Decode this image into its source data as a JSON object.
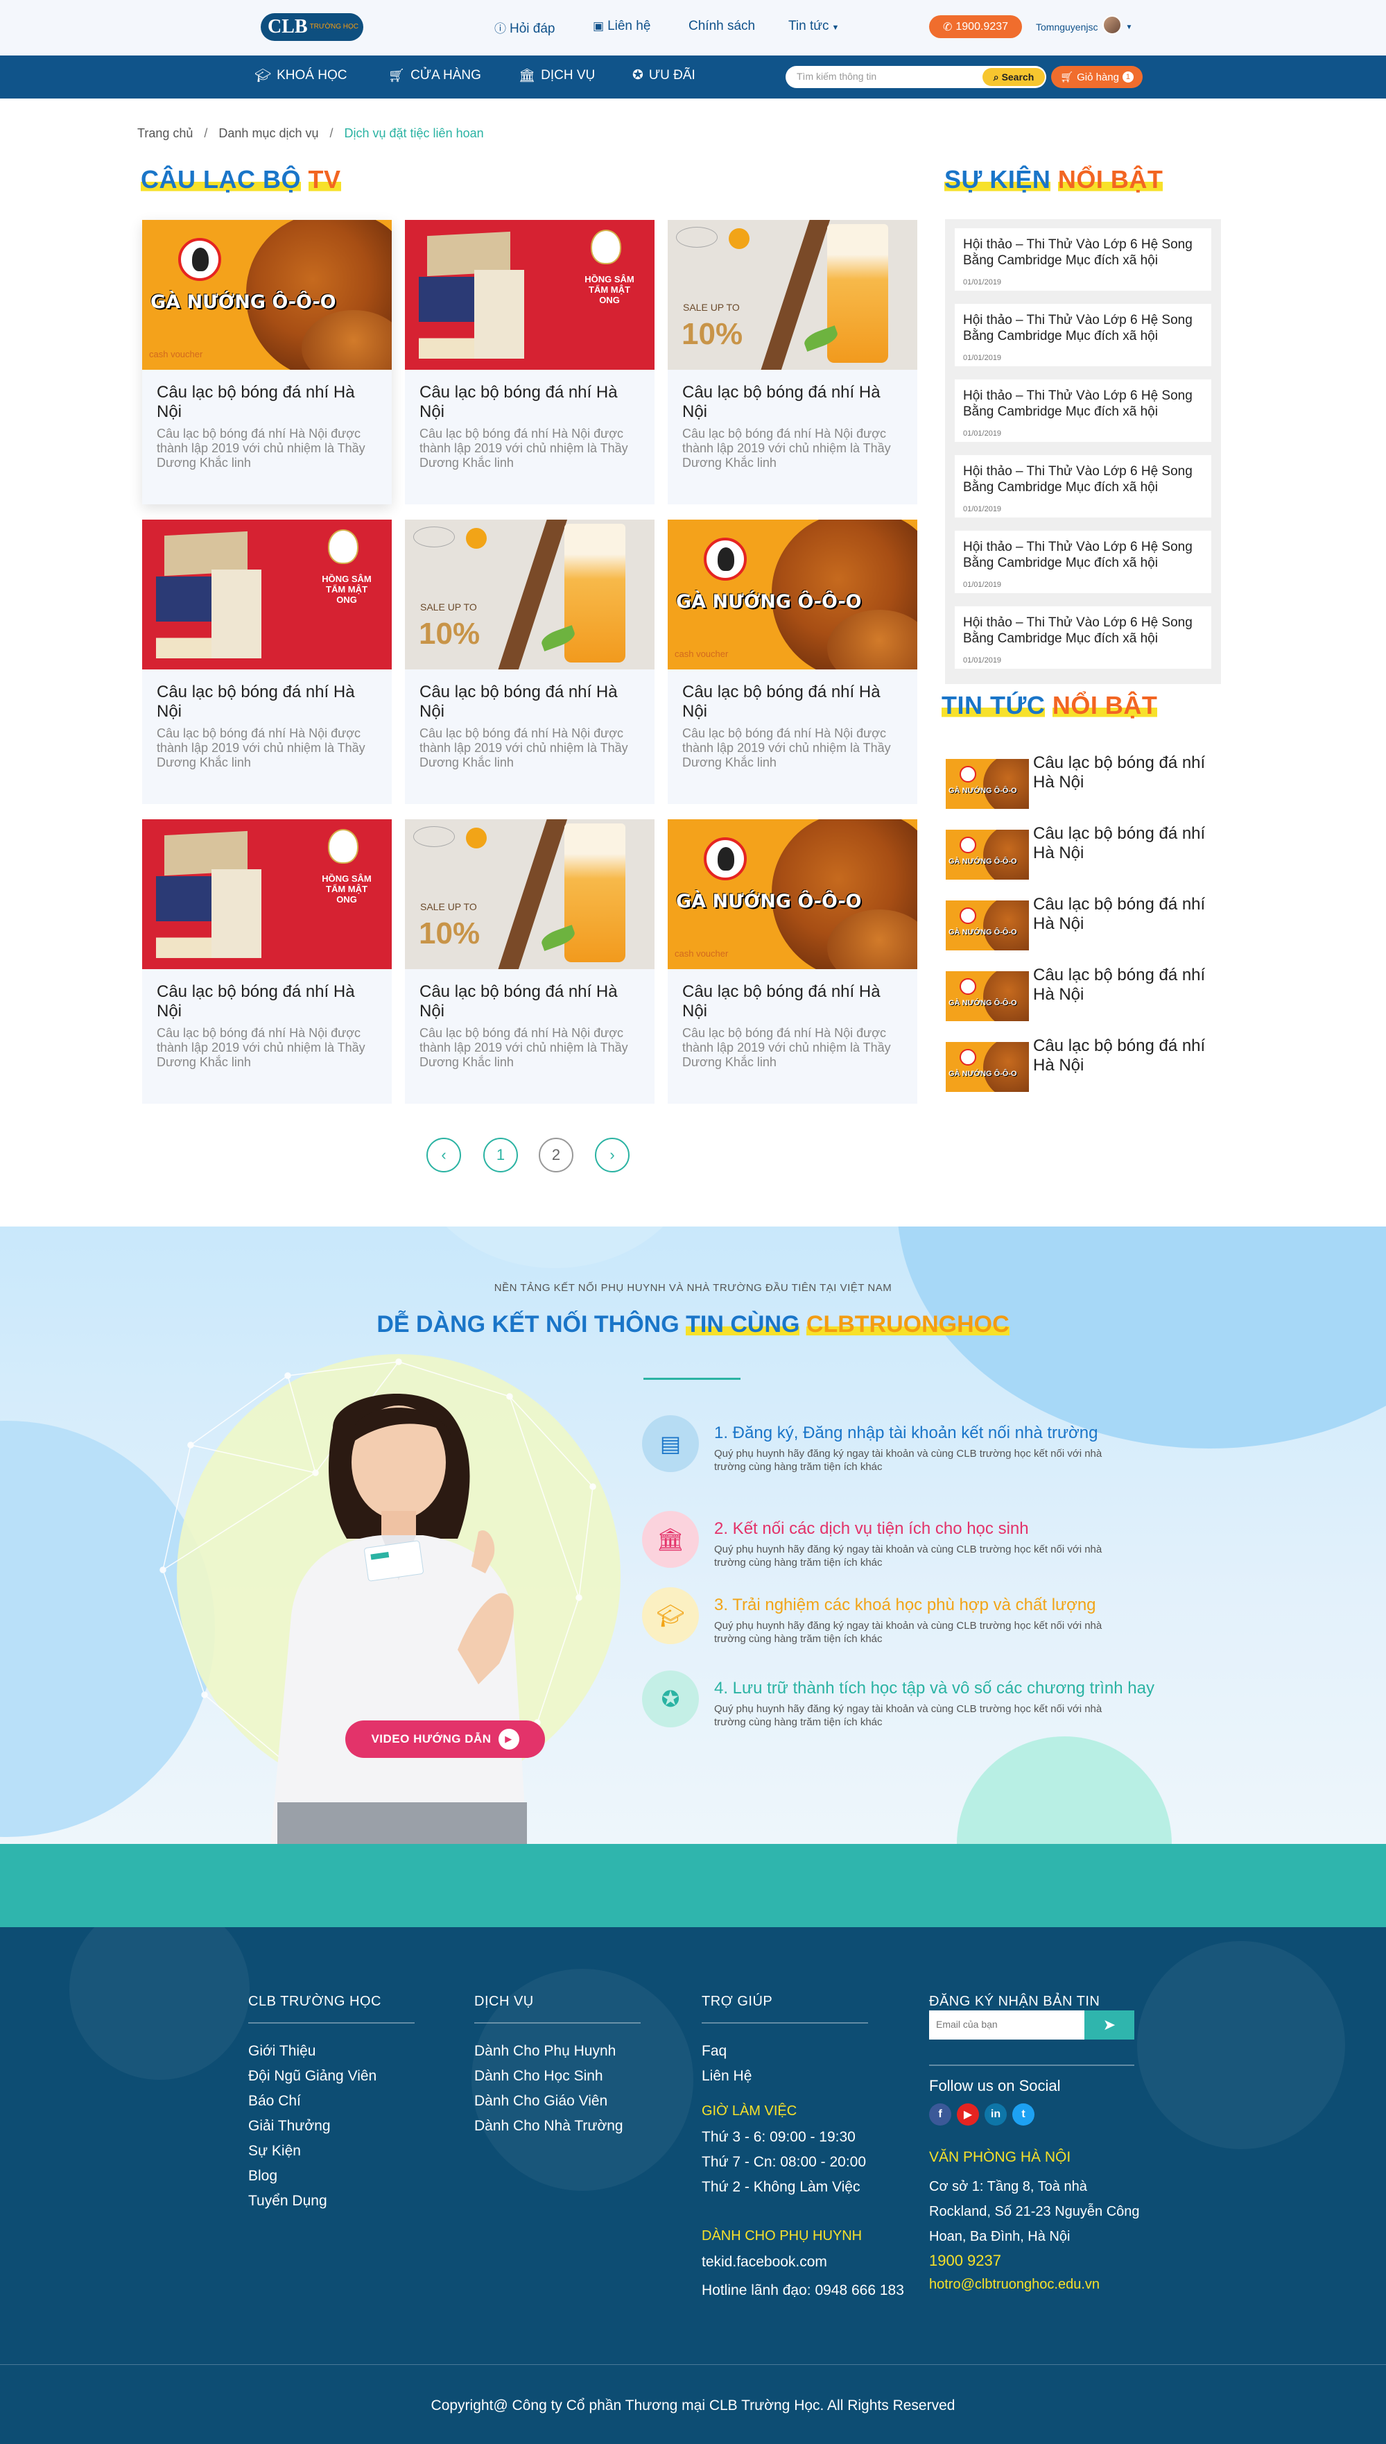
{
  "topbar": {
    "logo_main": "CLB",
    "logo_sub": "TRƯỜNG HỌC",
    "nav": [
      {
        "label": "Hỏi đáp",
        "icon": "question-icon"
      },
      {
        "label": "Liên hệ",
        "icon": "contact-icon"
      },
      {
        "label": "Chính sách",
        "icon": ""
      },
      {
        "label": "Tin tức",
        "icon": "chevron-down-icon"
      }
    ],
    "hotline": "1900.9237",
    "username": "Tomnguyenjsc"
  },
  "mainnav": {
    "items": [
      {
        "label": "KHOÁ HỌC",
        "icon": "graduation-cap-icon"
      },
      {
        "label": "CỬA HÀNG",
        "icon": "cart-icon"
      },
      {
        "label": "DỊCH VỤ",
        "icon": "bank-icon"
      },
      {
        "label": "ƯU ĐÃI",
        "icon": "medal-icon"
      }
    ],
    "search_placeholder": "Tìm kiếm thông tin",
    "search_button": "Search",
    "cart_label": "Giỏ hàng",
    "cart_count": "1"
  },
  "breadcrumb": {
    "items": [
      "Trang chủ",
      "Danh mục dịch vụ"
    ],
    "current": "Dịch vụ đặt tiệc liên hoan"
  },
  "main": {
    "title_part1": "CÂU LẠC BỘ",
    "title_part2": "TV",
    "cards": [
      {
        "image": "chicken",
        "title": "Câu lạc bộ bóng đá nhí Hà Nội",
        "desc": "Câu lạc bộ bóng đá nhí Hà Nội được thành lập 2019 với chủ nhiệm là Thầy Dương Khắc linh"
      },
      {
        "image": "ginseng",
        "title": "Câu lạc bộ bóng đá nhí Hà Nội",
        "desc": "Câu lạc bộ bóng đá nhí Hà Nội được thành lập 2019 với chủ nhiệm là Thầy Dương Khắc linh"
      },
      {
        "image": "tea",
        "title": "Câu lạc bộ bóng đá nhí Hà Nội",
        "desc": "Câu lạc bộ bóng đá nhí Hà Nội được thành lập 2019 với chủ nhiệm là Thầy Dương Khắc linh"
      },
      {
        "image": "ginseng",
        "title": "Câu lạc bộ bóng đá nhí Hà Nội",
        "desc": "Câu lạc bộ bóng đá nhí Hà Nội được thành lập 2019 với chủ nhiệm là Thầy Dương Khắc linh"
      },
      {
        "image": "tea",
        "title": "Câu lạc bộ bóng đá nhí Hà Nội",
        "desc": "Câu lạc bộ bóng đá nhí Hà Nội được thành lập 2019 với chủ nhiệm là Thầy Dương Khắc linh"
      },
      {
        "image": "chicken",
        "title": "Câu lạc bộ bóng đá nhí Hà Nội",
        "desc": "Câu lạc bộ bóng đá nhí Hà Nội được thành lập 2019 với chủ nhiệm là Thầy Dương Khắc linh"
      },
      {
        "image": "ginseng",
        "title": "Câu lạc bộ bóng đá nhí Hà Nội",
        "desc": "Câu lạc bộ bóng đá nhí Hà Nội được thành lập 2019 với chủ nhiệm là Thầy Dương Khắc linh"
      },
      {
        "image": "tea",
        "title": "Câu lạc bộ bóng đá nhí Hà Nội",
        "desc": "Câu lạc bộ bóng đá nhí Hà Nội được thành lập 2019 với chủ nhiệm là Thầy Dương Khắc linh"
      },
      {
        "image": "chicken",
        "title": "Câu lạc bộ bóng đá nhí Hà Nội",
        "desc": "Câu lạc bộ bóng đá nhí Hà Nội được thành lập 2019 với chủ nhiệm là Thầy Dương Khắc linh"
      }
    ],
    "img_text": {
      "chicken_brand": "GÀ NƯỚNG Ô-Ô-O",
      "chicken_voucher": "cash voucher",
      "ginseng_text": "HỒNG SÂM TẨM MẬT ONG",
      "tea_sale": "SALE UP TO",
      "tea_pct": "10%"
    },
    "pagination": {
      "prev": "‹",
      "pages": [
        "1",
        "2"
      ],
      "next": "›"
    }
  },
  "sidebar": {
    "events_title_part1": "SỰ KIỆN",
    "events_title_part2": "NỔI BẬT",
    "events": [
      {
        "title": "Hội thảo – Thi Thử Vào Lớp 6 Hệ Song Bằng Cambridge Mục đích xã hội",
        "date": "01/01/2019"
      },
      {
        "title": "Hội thảo – Thi Thử Vào Lớp 6 Hệ Song Bằng Cambridge Mục đích xã hội",
        "date": "01/01/2019"
      },
      {
        "title": "Hội thảo – Thi Thử Vào Lớp 6 Hệ Song Bằng Cambridge Mục đích xã hội",
        "date": "01/01/2019"
      },
      {
        "title": "Hội thảo – Thi Thử Vào Lớp 6 Hệ Song Bằng Cambridge Mục đích xã hội",
        "date": "01/01/2019"
      },
      {
        "title": "Hội thảo – Thi Thử Vào Lớp 6 Hệ Song Bằng Cambridge Mục đích xã hội",
        "date": "01/01/2019"
      },
      {
        "title": "Hội thảo – Thi Thử Vào Lớp 6 Hệ Song Bằng Cambridge Mục đích xã hội",
        "date": "01/01/2019"
      }
    ],
    "news_title_part1": "TIN TỨC",
    "news_title_part2": "NỔI BẬT",
    "news": [
      {
        "title": "Câu lạc bộ bóng đá nhí Hà Nội"
      },
      {
        "title": "Câu lạc bộ bóng đá nhí Hà Nội"
      },
      {
        "title": "Câu lạc bộ bóng đá nhí Hà Nội"
      },
      {
        "title": "Câu lạc bộ bóng đá nhí Hà Nội"
      },
      {
        "title": "Câu lạc bộ bóng đá nhí Hà Nội"
      }
    ]
  },
  "connect": {
    "subtitle": "NỀN TẢNG KẾT NỐI PHỤ HUYNH VÀ NHÀ TRƯỜNG ĐẦU TIÊN TẠI VIỆT NAM",
    "title_part1": "DỄ DÀNG KẾT NỐI THÔNG",
    "title_part2": "TIN CÙNG",
    "title_part3": "CLBTRUONGHOC",
    "video_button": "VIDEO HƯỚNG DẪN",
    "steps": [
      {
        "title": "1. Đăng ký, Đăng nhập tài khoản kết nối nhà trường",
        "desc": "Quý phụ huynh hãy đăng ký ngay tài khoản và cùng CLB trường học kết nối với nhà trường cùng hàng trăm tiện ích khác",
        "color": "#1a75c8",
        "bg": "#b6dcf3",
        "icon": "id-card-icon"
      },
      {
        "title": "2. Kết nối các dịch vụ tiện ích cho học sinh",
        "desc": "Quý phụ huynh hãy đăng ký ngay tài khoản và cùng CLB trường học kết nối với nhà trường cùng hàng trăm tiện ích khác",
        "color": "#e3336a",
        "bg": "#fbd3dd",
        "icon": "bank-icon"
      },
      {
        "title": "3. Trải nghiệm các khoá học phù hợp và chất lượng",
        "desc": "Quý phụ huynh hãy đăng ký ngay tài khoản và cùng CLB trường học kết nối với nhà trường cùng hàng trăm tiện ích khác",
        "color": "#f2a417",
        "bg": "#fbf0c2",
        "icon": "graduation-cap-icon"
      },
      {
        "title": "4. Lưu trữ thành tích học tập và vô số các chương trình hay",
        "desc": "Quý phụ huynh hãy đăng ký ngay tài khoản và cùng CLB trường học kết nối với nhà trường cùng hàng trăm tiện ích khác",
        "color": "#2bb3a3",
        "bg": "#c4efe6",
        "icon": "award-icon"
      }
    ]
  },
  "footer": {
    "col1_title": "CLB TRƯỜNG HỌC",
    "col1_items": [
      "Giới Thiệu",
      "Đội Ngũ Giảng Viên",
      "Báo Chí",
      "Giải Thưởng",
      "Sự Kiện",
      "Blog",
      "Tuyển Dụng"
    ],
    "col2_title": "DỊCH VỤ",
    "col2_items": [
      "Dành Cho Phụ Huynh",
      "Dành Cho Học Sinh",
      "Dành Cho Giáo Viên",
      "Dành Cho Nhà Trường"
    ],
    "col3_title": "TRỢ GIÚP",
    "col3_items": [
      "Faq",
      "Liên Hệ"
    ],
    "hours_title": "GIỜ LÀM VIỆC",
    "hours": [
      "Thứ 3 - 6: 09:00 - 19:30",
      "Thứ 7 - Cn: 08:00 - 20:00",
      "Thứ 2 - Không Làm Việc"
    ],
    "parents_title": "DÀNH CHO PHỤ HUYNH",
    "parents_link": "tekid.facebook.com",
    "hotline_label": "Hotline lãnh đạo: 0948 666 183",
    "col4_title": "ĐĂNG KÝ NHẬN BẢN TIN",
    "email_placeholder": "Email của bạn",
    "social_title": "Follow us on Social",
    "social": [
      {
        "icon": "facebook-icon",
        "glyph": "f",
        "color": "#3b5998"
      },
      {
        "icon": "youtube-icon",
        "glyph": "▶",
        "color": "#e52421"
      },
      {
        "icon": "linkedin-icon",
        "glyph": "in",
        "color": "#0e76a8"
      },
      {
        "icon": "twitter-icon",
        "glyph": "t",
        "color": "#1da1f2"
      }
    ],
    "office_title": "VĂN PHÒNG HÀ NỘI",
    "office_address": "Cơ sở 1: Tầng 8, Toà nhà Rockland, Số 21-23 Nguyễn Công Hoan, Ba Đình, Hà Nội",
    "office_phone": "1900 9237",
    "office_email": "hotro@clbtruonghoc.edu.vn",
    "copyright": "Copyright@ Công ty Cổ phần Thương mại CLB Trường Học. All Rights Reserved"
  }
}
